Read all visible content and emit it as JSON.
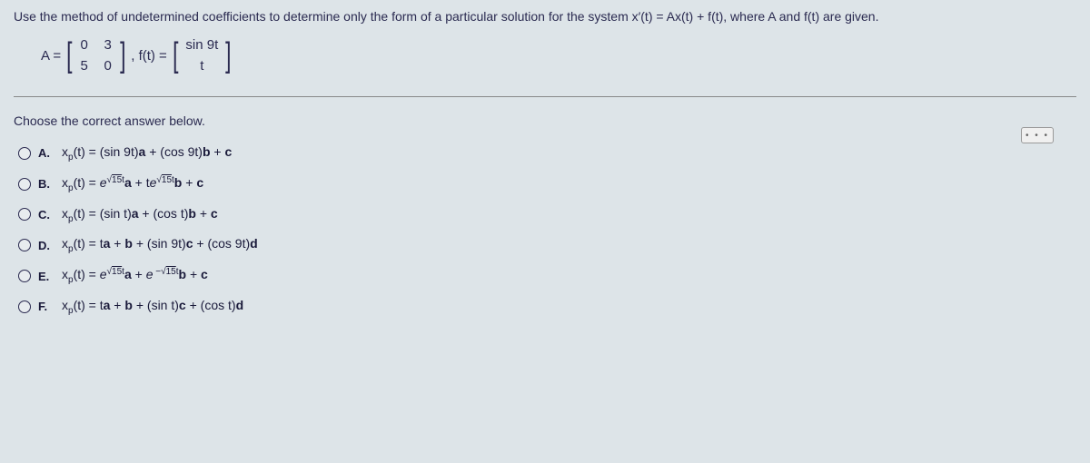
{
  "question": "Use the method of undetermined coefficients to determine only the form of a particular solution for the system x′(t) = Ax(t) + f(t), where A and f(t) are given.",
  "matrix": {
    "A_label": "A =",
    "a11": "0",
    "a12": "3",
    "a21": "5",
    "a22": "0",
    "f_label": ", f(t) =",
    "f1": "sin 9t",
    "f2": "t"
  },
  "prompt": "Choose the correct answer below.",
  "options": {
    "A": {
      "label": "A.",
      "formula_plain": "x_p(t) = (sin 9t)a + (cos 9t)b + c"
    },
    "B": {
      "label": "B.",
      "formula_plain": "x_p(t) = e^(√15 t) a + t e^(√15 t) b + c"
    },
    "C": {
      "label": "C.",
      "formula_plain": "x_p(t) = (sin t)a + (cos t)b + c"
    },
    "D": {
      "label": "D.",
      "formula_plain": "x_p(t) = ta + b + (sin 9t)c + (cos 9t)d"
    },
    "E": {
      "label": "E.",
      "formula_plain": "x_p(t) = e^(√15 t) a + e^(-√15 t) b + c"
    },
    "F": {
      "label": "F.",
      "formula_plain": "x_p(t) = ta + b + (sin t)c + (cos t)d"
    }
  },
  "dots": "• • •"
}
